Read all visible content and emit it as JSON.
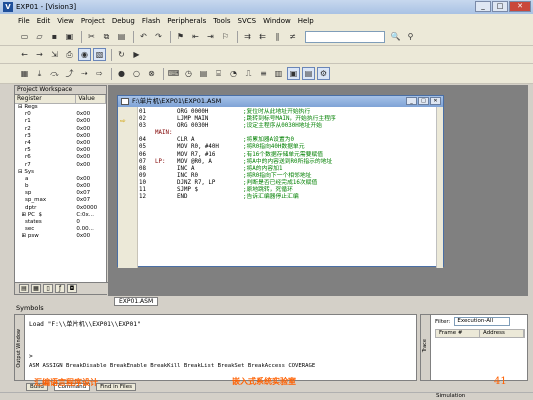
{
  "window": {
    "title": "EXP01 - [Vision3]",
    "app_icon": "V"
  },
  "menu": [
    "File",
    "Edit",
    "View",
    "Project",
    "Debug",
    "Flash",
    "Peripherals",
    "Tools",
    "SVCS",
    "Window",
    "Help"
  ],
  "workspace": {
    "title": "Project Workspace",
    "col_register": "Register",
    "col_value": "Value",
    "rows": [
      {
        "name": "⊟ Regs",
        "value": ""
      },
      {
        "name": "    r0",
        "value": "0x00"
      },
      {
        "name": "    r1",
        "value": "0x00"
      },
      {
        "name": "    r2",
        "value": "0x00"
      },
      {
        "name": "    r3",
        "value": "0x00"
      },
      {
        "name": "    r4",
        "value": "0x00"
      },
      {
        "name": "    r5",
        "value": "0x00"
      },
      {
        "name": "    r6",
        "value": "0x00"
      },
      {
        "name": "    r7",
        "value": "0x00"
      },
      {
        "name": "⊟ Sys",
        "value": ""
      },
      {
        "name": "    a",
        "value": "0x00"
      },
      {
        "name": "    b",
        "value": "0x00"
      },
      {
        "name": "    sp",
        "value": "0x07"
      },
      {
        "name": "    sp_max",
        "value": "0x07"
      },
      {
        "name": "    dptr",
        "value": "0x0000"
      },
      {
        "name": "  ⊞ PC  $",
        "value": "C:0x..."
      },
      {
        "name": "    states",
        "value": "0"
      },
      {
        "name": "    sec",
        "value": "0.00..."
      },
      {
        "name": "  ⊞ psw",
        "value": "0x00"
      }
    ]
  },
  "editor": {
    "title": "F:\\单片机\\EXP01\\EXP01.ASM",
    "lines": [
      {
        "n": "01",
        "label": "",
        "ins": "ORG 0000H",
        "cm": ";复位时从此地址开始执行"
      },
      {
        "n": "02",
        "label": "",
        "ins": "LJMP MAIN",
        "cm": ";跳转到标号MAIN，开始执行主程序"
      },
      {
        "n": "03",
        "label": "",
        "ins": "ORG 0030H",
        "cm": ";设定主程序从0030H地址开始"
      },
      {
        "n": "",
        "label": "MAIN:",
        "ins": "",
        "cm": ""
      },
      {
        "n": "04",
        "label": "",
        "ins": "CLR A",
        "cm": ";将累加器A设置为0"
      },
      {
        "n": "05",
        "label": "",
        "ins": "MOV R0, #40H",
        "cm": ";将R0指向40H数据单元"
      },
      {
        "n": "06",
        "label": "",
        "ins": "MOV R7, #16",
        "cm": ";有16个数据存储单元需要赋值"
      },
      {
        "n": "07",
        "label": "LP:",
        "ins": "MOV @R0, A",
        "cm": ";将A中的内容送到R0所指示的地址"
      },
      {
        "n": "08",
        "label": "",
        "ins": "INC A",
        "cm": ";将A的内容加1"
      },
      {
        "n": "09",
        "label": "",
        "ins": "INC R0",
        "cm": ";将R0指向下一个相邻地址"
      },
      {
        "n": "10",
        "label": "",
        "ins": "DJNZ R7, LP",
        "cm": ";判断是否已经完成16次赋值"
      },
      {
        "n": "11",
        "label": "",
        "ins": "SJMP $",
        "cm": ";原地跳转，死循环"
      },
      {
        "n": "12",
        "label": "",
        "ins": "END",
        "cm": ";告诉汇编器停止汇编"
      }
    ]
  },
  "doc_tab": "EXP01.ASM",
  "symbols_label": "Symbols",
  "output": {
    "side_label": "Output Window",
    "line1": "Load \"F:\\\\单片机\\\\EXP01\\\\EXP01\"",
    "prompt": ">",
    "cmds": "ASM ASSIGN BreakDisable BreakEnable BreakKill BreakList BreakSet BreakAccess COVERAGE",
    "tabs": [
      "Build",
      "Command",
      "Find in Files"
    ]
  },
  "stack": {
    "filter_label": "Filter:",
    "filter_value": "Execution-All",
    "col1": "Frame #",
    "col2": "Address",
    "side_label": "Trace"
  },
  "status": {
    "mode": "Simulation"
  },
  "notes": {
    "left": "汇编语言程序设计",
    "center": "嵌入式系统实验室",
    "page": "41"
  }
}
